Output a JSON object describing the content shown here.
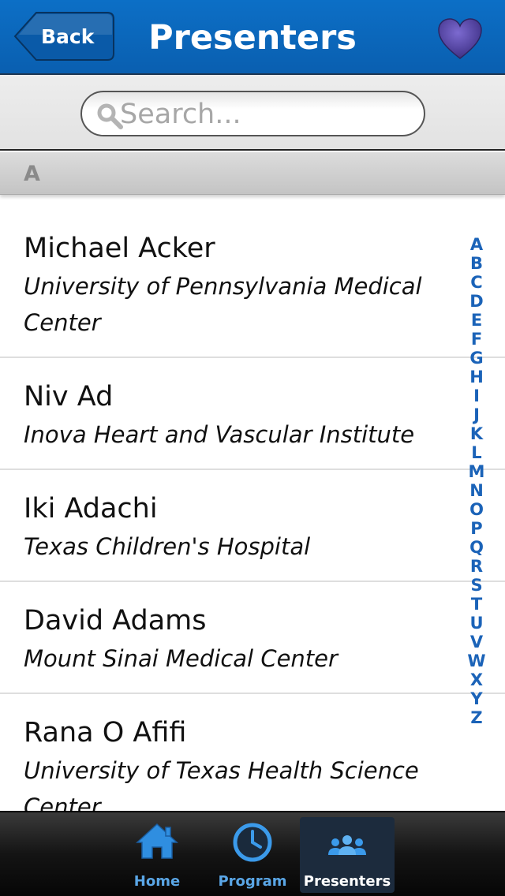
{
  "header": {
    "back_label": "Back",
    "title": "Presenters",
    "icons": {
      "back": "chevron-left-button",
      "favorite": "heart-icon"
    },
    "colors": {
      "bar": "#0a62b6",
      "heart": "#5b4ba6"
    }
  },
  "search": {
    "placeholder": "Search...",
    "value": "",
    "icon": "search-icon"
  },
  "section": {
    "letter": "A"
  },
  "presenters": [
    {
      "name": "Michael Acker",
      "institution": "University of Pennsylvania Medical Center"
    },
    {
      "name": "Niv Ad",
      "institution": "Inova Heart and Vascular Institute"
    },
    {
      "name": "Iki Adachi",
      "institution": "Texas Children's Hospital"
    },
    {
      "name": "David Adams",
      "institution": "Mount Sinai Medical Center"
    },
    {
      "name": "Rana O Afifi",
      "institution": "University of Texas Health Science Center"
    }
  ],
  "alphabet": [
    "A",
    "B",
    "C",
    "D",
    "E",
    "F",
    "G",
    "H",
    "I",
    "J",
    "K",
    "L",
    "M",
    "N",
    "O",
    "P",
    "Q",
    "R",
    "S",
    "T",
    "U",
    "V",
    "W",
    "X",
    "Y",
    "Z"
  ],
  "tabs": [
    {
      "label": "Home",
      "icon": "home-icon",
      "active": false
    },
    {
      "label": "Program",
      "icon": "clock-icon",
      "active": false
    },
    {
      "label": "Presenters",
      "icon": "people-icon",
      "active": true
    }
  ],
  "colors": {
    "accent": "#1b63b8",
    "tab_label": "#5aa6e6"
  }
}
